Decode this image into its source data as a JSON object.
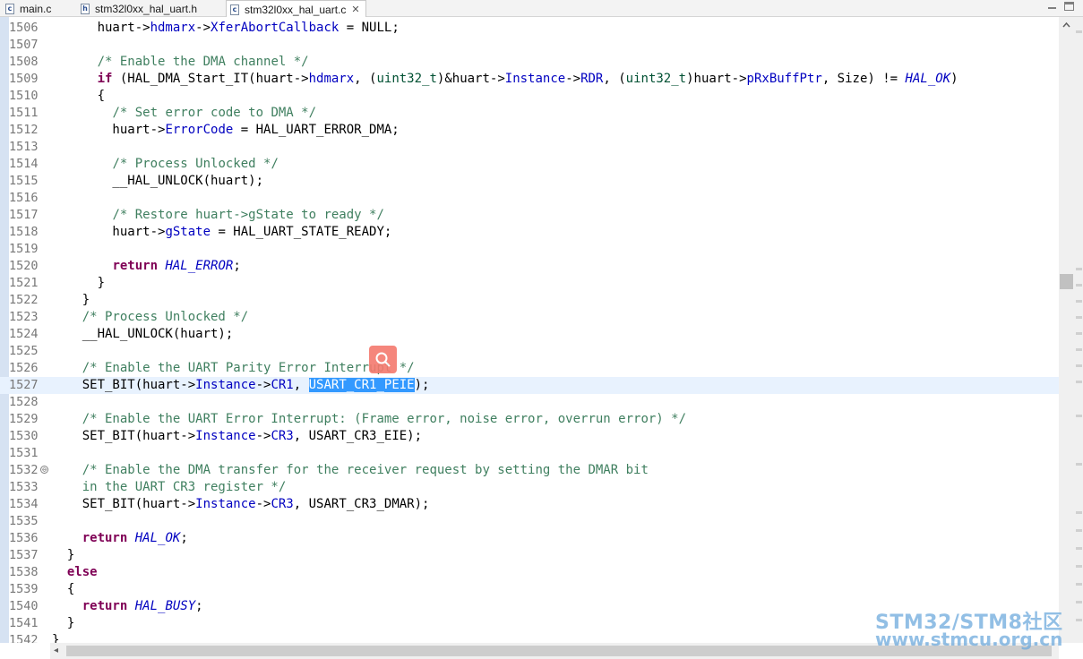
{
  "tabs": [
    {
      "label": "main.c",
      "type": "c"
    },
    {
      "label": "stm32l0xx_hal_uart.h",
      "type": "h"
    },
    {
      "label": "stm32l0xx_hal_uart.c",
      "type": "c",
      "active": true,
      "close": "✕"
    }
  ],
  "editor": {
    "lines": [
      {
        "n": "1506",
        "t": [
          [
            "",
            "      huart->"
          ],
          [
            "fld",
            "hdmarx"
          ],
          [
            "",
            "->"
          ],
          [
            "fld",
            "XferAbortCallback"
          ],
          [
            "",
            " = NULL;"
          ]
        ]
      },
      {
        "n": "1507",
        "t": []
      },
      {
        "n": "1508",
        "t": [
          [
            "",
            "      "
          ],
          [
            "cm",
            "/* Enable the DMA channel */"
          ]
        ]
      },
      {
        "n": "1509",
        "t": [
          [
            "",
            "      "
          ],
          [
            "kw",
            "if"
          ],
          [
            "",
            " (HAL_DMA_Start_IT(huart->"
          ],
          [
            "fld",
            "hdmarx"
          ],
          [
            "",
            ", ("
          ],
          [
            "typ",
            "uint32_t"
          ],
          [
            "",
            ")&huart->"
          ],
          [
            "fld",
            "Instance"
          ],
          [
            "",
            "->"
          ],
          [
            "fld",
            "RDR"
          ],
          [
            "",
            ", ("
          ],
          [
            "typ",
            "uint32_t"
          ],
          [
            "",
            ")huart->"
          ],
          [
            "fld",
            "pRxBuffPtr"
          ],
          [
            "",
            ", Size) != "
          ],
          [
            "ital",
            "HAL_OK"
          ],
          [
            "",
            ")"
          ]
        ]
      },
      {
        "n": "1510",
        "t": [
          [
            "",
            "      {"
          ]
        ]
      },
      {
        "n": "1511",
        "t": [
          [
            "",
            "        "
          ],
          [
            "cm",
            "/* Set error code to DMA */"
          ]
        ]
      },
      {
        "n": "1512",
        "t": [
          [
            "",
            "        huart->"
          ],
          [
            "fld",
            "ErrorCode"
          ],
          [
            "",
            " = HAL_UART_ERROR_DMA;"
          ]
        ]
      },
      {
        "n": "1513",
        "t": []
      },
      {
        "n": "1514",
        "t": [
          [
            "",
            "        "
          ],
          [
            "cm",
            "/* Process Unlocked */"
          ]
        ]
      },
      {
        "n": "1515",
        "t": [
          [
            "",
            "        __HAL_UNLOCK(huart);"
          ]
        ]
      },
      {
        "n": "1516",
        "t": []
      },
      {
        "n": "1517",
        "t": [
          [
            "",
            "        "
          ],
          [
            "cm",
            "/* Restore huart->gState to ready */"
          ]
        ]
      },
      {
        "n": "1518",
        "t": [
          [
            "",
            "        huart->"
          ],
          [
            "fld",
            "gState"
          ],
          [
            "",
            " = HAL_UART_STATE_READY;"
          ]
        ]
      },
      {
        "n": "1519",
        "t": []
      },
      {
        "n": "1520",
        "t": [
          [
            "",
            "        "
          ],
          [
            "kw",
            "return"
          ],
          [
            "",
            " "
          ],
          [
            "ital",
            "HAL_ERROR"
          ],
          [
            "",
            ";"
          ]
        ]
      },
      {
        "n": "1521",
        "t": [
          [
            "",
            "      }"
          ]
        ]
      },
      {
        "n": "1522",
        "t": [
          [
            "",
            "    }"
          ]
        ]
      },
      {
        "n": "1523",
        "t": [
          [
            "",
            "    "
          ],
          [
            "cm",
            "/* Process Unlocked */"
          ]
        ]
      },
      {
        "n": "1524",
        "t": [
          [
            "",
            "    __HAL_UNLOCK(huart);"
          ]
        ]
      },
      {
        "n": "1525",
        "t": []
      },
      {
        "n": "1526",
        "t": [
          [
            "",
            "    "
          ],
          [
            "cm",
            "/* Enable the UART Parity Error Interrupt */"
          ]
        ]
      },
      {
        "n": "1527",
        "cur": true,
        "t": [
          [
            "",
            "    SET_BIT(huart->"
          ],
          [
            "fld",
            "Instance"
          ],
          [
            "",
            "->"
          ],
          [
            "fld",
            "CR1"
          ],
          [
            "",
            ", "
          ],
          [
            "sel",
            "USART_CR1_PEIE"
          ],
          [
            "",
            ");"
          ]
        ]
      },
      {
        "n": "1528",
        "t": []
      },
      {
        "n": "1529",
        "t": [
          [
            "",
            "    "
          ],
          [
            "cm",
            "/* Enable the UART Error Interrupt: (Frame error, noise error, overrun error) */"
          ]
        ]
      },
      {
        "n": "1530",
        "t": [
          [
            "",
            "    SET_BIT(huart->"
          ],
          [
            "fld",
            "Instance"
          ],
          [
            "",
            "->"
          ],
          [
            "fld",
            "CR3"
          ],
          [
            "",
            ", USART_CR3_EIE);"
          ]
        ]
      },
      {
        "n": "1531",
        "t": []
      },
      {
        "n": "1532",
        "fold": "⊖",
        "t": [
          [
            "",
            "    "
          ],
          [
            "cm",
            "/* Enable the DMA transfer for the receiver request by setting the DMAR bit"
          ]
        ]
      },
      {
        "n": "1533",
        "t": [
          [
            "",
            "    "
          ],
          [
            "cm",
            "in the UART CR3 register */"
          ]
        ]
      },
      {
        "n": "1534",
        "t": [
          [
            "",
            "    SET_BIT(huart->"
          ],
          [
            "fld",
            "Instance"
          ],
          [
            "",
            "->"
          ],
          [
            "fld",
            "CR3"
          ],
          [
            "",
            ", USART_CR3_DMAR);"
          ]
        ]
      },
      {
        "n": "1535",
        "t": []
      },
      {
        "n": "1536",
        "t": [
          [
            "",
            "    "
          ],
          [
            "kw",
            "return"
          ],
          [
            "",
            " "
          ],
          [
            "ital",
            "HAL_OK"
          ],
          [
            "",
            ";"
          ]
        ]
      },
      {
        "n": "1537",
        "t": [
          [
            "",
            "  }"
          ]
        ]
      },
      {
        "n": "1538",
        "t": [
          [
            "",
            "  "
          ],
          [
            "kw",
            "else"
          ]
        ]
      },
      {
        "n": "1539",
        "t": [
          [
            "",
            "  {"
          ]
        ]
      },
      {
        "n": "1540",
        "t": [
          [
            "",
            "    "
          ],
          [
            "kw",
            "return"
          ],
          [
            "",
            " "
          ],
          [
            "ital",
            "HAL_BUSY"
          ],
          [
            "",
            ";"
          ]
        ]
      },
      {
        "n": "1541",
        "t": [
          [
            "",
            "  }"
          ]
        ]
      },
      {
        "n": "1542",
        "t": [
          [
            "",
            "}"
          ]
        ]
      }
    ]
  },
  "icons": {
    "search": "search-icon",
    "scroll_left": "◂",
    "scroll_up": "▴"
  },
  "watermark": {
    "line1": "STM32/STM8社区",
    "line2": "www.stmcu.org.cn"
  },
  "colors": {
    "keyword": "#7f0055",
    "comment": "#3f7f5f",
    "field": "#0000c0",
    "selection": "#3399ff",
    "current_line": "#e8f2fe"
  }
}
